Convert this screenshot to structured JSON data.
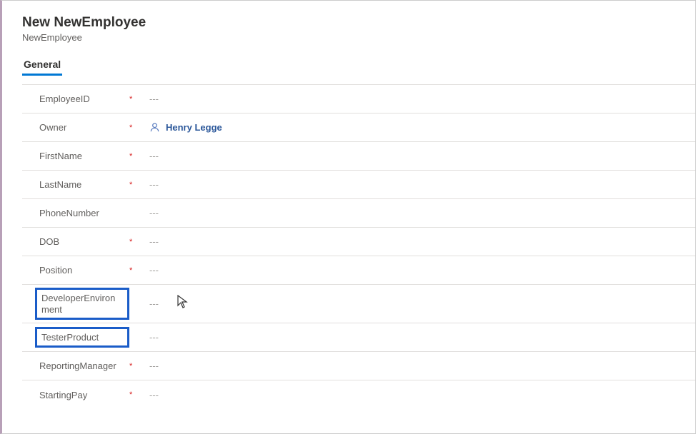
{
  "header": {
    "title": "New NewEmployee",
    "subtitle": "NewEmployee"
  },
  "tabs": {
    "general": "General"
  },
  "fields": {
    "employeeId": {
      "label": "EmployeeID",
      "required": "*",
      "value": "---"
    },
    "owner": {
      "label": "Owner",
      "required": "*",
      "person": "Henry Legge"
    },
    "firstName": {
      "label": "FirstName",
      "required": "*",
      "value": "---"
    },
    "lastName": {
      "label": "LastName",
      "required": "*",
      "value": "---"
    },
    "phoneNumber": {
      "label": "PhoneNumber",
      "required": "",
      "value": "---"
    },
    "dob": {
      "label": "DOB",
      "required": "*",
      "value": "---"
    },
    "position": {
      "label": "Position",
      "required": "*",
      "value": "---"
    },
    "developerEnvironment": {
      "label": "DeveloperEnvironment",
      "required": "",
      "value": "---"
    },
    "testerProduct": {
      "label": "TesterProduct",
      "required": "",
      "value": "---"
    },
    "reportingManager": {
      "label": "ReportingManager",
      "required": "*",
      "value": "---"
    },
    "startingPay": {
      "label": "StartingPay",
      "required": "*",
      "value": "---"
    }
  }
}
